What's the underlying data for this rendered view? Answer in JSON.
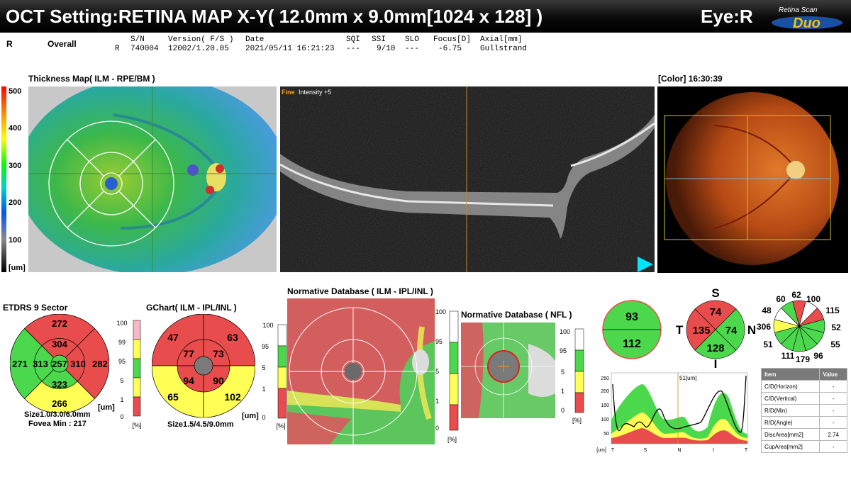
{
  "header": {
    "title": "OCT Setting:RETINA MAP X-Y( 12.0mm x 9.0mm[1024 x 128] )",
    "eye": "Eye:R",
    "logo_line1": "Retina Scan",
    "logo_line2": "Duo"
  },
  "info": {
    "eye_letter": "R",
    "overall": "Overall",
    "col_labels": [
      "S/N",
      "Version( F/S )",
      "Date",
      "SQI",
      "SSI",
      "SLO",
      "Focus[D]",
      "Axial[mm]"
    ],
    "eye_row": "R",
    "values": [
      "740004",
      "12002/1.20.05",
      "2021/05/11 16:21:23",
      "---",
      "9/10",
      "---",
      "-6.75",
      "Gullstrand"
    ]
  },
  "thickness_map": {
    "title": "Thickness Map( ILM - RPE/BM )",
    "scale": [
      "500",
      "400",
      "300",
      "200",
      "100"
    ],
    "unit": "[um]"
  },
  "bscan": {
    "fine": "Fine",
    "intensity": "Intensity +5"
  },
  "fundus": {
    "title": "[Color] 16:30:39"
  },
  "etdrs": {
    "title": "ETDRS 9 Sector",
    "values": {
      "outer_s": "272",
      "outer_n": "282",
      "outer_i": "266",
      "outer_t": "271",
      "inner_s": "304",
      "inner_n": "310",
      "inner_i": "323",
      "inner_t": "313",
      "center": "257"
    },
    "size_label": "Size1.0/3.0/6.0mm",
    "fovea": "Fovea Min : 217",
    "unit": "[um]"
  },
  "percentile_scale_a": {
    "ticks": [
      "100",
      "99",
      "95",
      "5",
      "1",
      "0"
    ],
    "unit": "[%]"
  },
  "gchart": {
    "title": "GChart( ILM - IPL/INL )",
    "values": {
      "out_tl": "47",
      "out_tr": "63",
      "out_bl": "65",
      "out_br": "102",
      "in_tl": "77",
      "in_tr": "73",
      "in_bl": "94",
      "in_br": "90"
    },
    "size_label": "Size1.5/4.5/9.0mm",
    "unit": "[um]"
  },
  "percentile_scale_b": {
    "ticks": [
      "100",
      "95",
      "5",
      "1",
      "0"
    ],
    "unit": "[%]"
  },
  "normative_gcl": {
    "title": "Normative Database ( ILM - IPL/INL )",
    "ticks": [
      "100",
      "95",
      "5",
      "1",
      "0"
    ],
    "unit": "[%]"
  },
  "normative_nfl": {
    "title": "Normative Database ( NFL )",
    "ticks": [
      "100",
      "95",
      "5",
      "1",
      "0"
    ],
    "unit": "[%]"
  },
  "nfl_halves": {
    "superior": "93",
    "inferior": "112"
  },
  "nfl_quadrants": {
    "S": "74",
    "T": "135",
    "N": "74",
    "I": "128",
    "label_s": "S",
    "label_t": "T",
    "label_n": "N",
    "label_i": "I"
  },
  "nfl_clock": {
    "labels": [
      "60",
      "62",
      "100",
      "115",
      "52",
      "55",
      "96",
      "179",
      "111",
      "51",
      "306",
      "48"
    ],
    "colors": [
      "#e84c4c",
      "#ffffff",
      "#e84c4c",
      "#4cd84c",
      "#4cd84c",
      "#4cd84c",
      "#4cd84c",
      "#4cd84c",
      "#4cd84c",
      "#ffff55",
      "#ffffff",
      "#4cd84c"
    ]
  },
  "tsnit": {
    "title": "51[um]",
    "y_ticks": [
      "250",
      "200",
      "150",
      "100",
      "50"
    ],
    "x_ticks": [
      "T",
      "S",
      "N",
      "I",
      "T"
    ],
    "unit": "[um]"
  },
  "item_table": {
    "headers": [
      "Item",
      "Value"
    ],
    "rows": [
      {
        "item": "C/D(Horizon)",
        "value": "-"
      },
      {
        "item": "C/D(Vertical)",
        "value": "-"
      },
      {
        "item": "R/D(Min)",
        "value": "-"
      },
      {
        "item": "R/D(Angle)",
        "value": "-"
      },
      {
        "item": "DiscArea[mm2]",
        "value": "2.74"
      },
      {
        "item": "CupArea[mm2]",
        "value": "-"
      }
    ]
  },
  "colors": {
    "normal": "#4cd84c",
    "borderline": "#ffff55",
    "abnormal": "#e84c4c",
    "accent": "#00e5ff"
  }
}
